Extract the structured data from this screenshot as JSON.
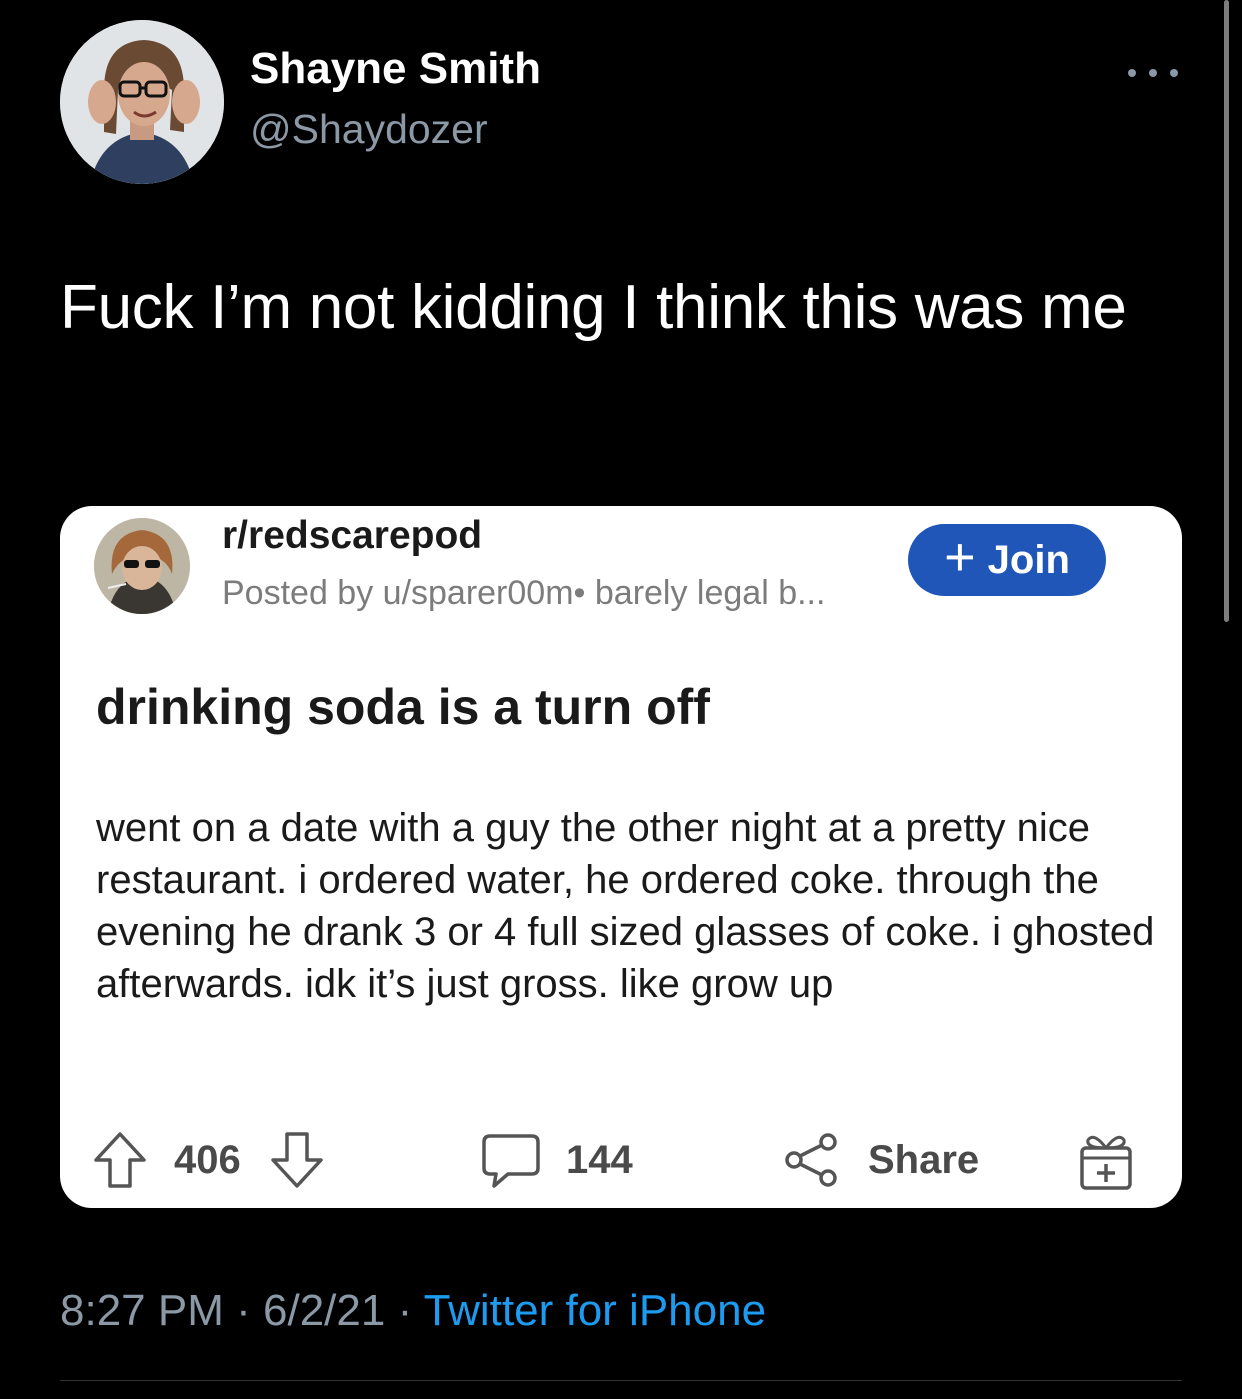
{
  "tweet": {
    "display_name": "Shayne Smith",
    "handle": "@Shaydozer",
    "text": "Fuck I’m not kidding I think this was me",
    "timestamp": {
      "time": "8:27 PM",
      "separator": "·",
      "date": "6/2/21",
      "source": "Twitter for iPhone"
    },
    "more_icon": "more-horizontal-icon"
  },
  "embedded_post": {
    "subreddit": "r/redscarepod",
    "posted_by": "Posted by u/sparer00m• barely legal b...",
    "join_label": "Join",
    "join_icon": "plus-icon",
    "title": "drinking soda is a turn off",
    "body": "went on a date with a guy the other night at a pretty nice restaurant. i ordered water, he ordered coke. through the evening he drank 3 or 4 full sized glasses of coke. i ghosted afterwards. idk it’s just gross. like grow up",
    "upvotes": "406",
    "comments": "144",
    "share_label": "Share",
    "icons": [
      "upvote-arrow-icon",
      "downvote-arrow-icon",
      "comment-bubble-icon",
      "share-icon",
      "gift-icon"
    ]
  },
  "colors": {
    "background": "#000000",
    "muted_text": "#8b98a5",
    "link_blue": "#1d9bf0",
    "join_button": "#1f56b8"
  }
}
